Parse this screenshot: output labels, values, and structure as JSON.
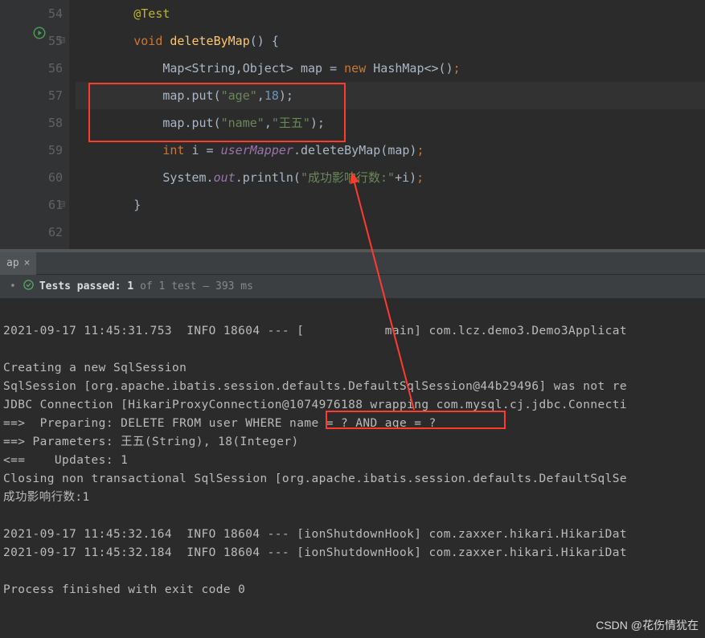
{
  "gutter": {
    "lines": [
      "54",
      "55",
      "56",
      "57",
      "58",
      "59",
      "60",
      "61",
      "62"
    ]
  },
  "code": {
    "l54_ann": "@Test",
    "l55_kw": "void",
    "l55_name": "deleteByMap",
    "l55_paren": "()",
    "l55_brace": " {",
    "l56_a": "Map<String,Object> map = ",
    "l56_new": "new ",
    "l56_b": "HashMap<>()",
    "l56_end": ";",
    "l57_a": "map.put(",
    "l57_k": "\"age\"",
    "l57_c": ",",
    "l57_v": "18",
    "l57_end": ");",
    "l58_a": "map.put(",
    "l58_k": "\"name\"",
    "l58_c": ",",
    "l58_v": "\"王五\"",
    "l58_end": ");",
    "l59_int": "int ",
    "l59_a": "i = ",
    "l59_b": "userMapper",
    "l59_c": ".deleteByMap(map)",
    "l59_end": ";",
    "l60_a": "System.",
    "l60_out": "out",
    "l60_b": ".println(",
    "l60_str": "\"成功影响行数:\"",
    "l60_c": "+i)",
    "l60_end": ";",
    "l61_brace": "}"
  },
  "tab": {
    "label": "ap",
    "close_glyph": "×"
  },
  "results": {
    "prefix": "Tests passed:",
    "count": "1",
    "of": "of 1 test",
    "dash": "– 393 ms"
  },
  "console": {
    "lines": [
      "2021-09-17 11:45:31.753  INFO 18604 --- [           main] com.lcz.demo3.Demo3Applicat",
      "",
      "Creating a new SqlSession",
      "SqlSession [org.apache.ibatis.session.defaults.DefaultSqlSession@44b29496] was not re",
      "JDBC Connection [HikariProxyConnection@1074976188 wrapping com.mysql.cj.jdbc.Connecti",
      "==>  Preparing: DELETE FROM user WHERE name = ? AND age = ?",
      "==> Parameters: 王五(String), 18(Integer)",
      "<==    Updates: 1",
      "Closing non transactional SqlSession [org.apache.ibatis.session.defaults.DefaultSqlSe",
      "成功影响行数:1",
      "",
      "2021-09-17 11:45:32.164  INFO 18604 --- [ionShutdownHook] com.zaxxer.hikari.HikariDat",
      "2021-09-17 11:45:32.184  INFO 18604 --- [ionShutdownHook] com.zaxxer.hikari.HikariDat",
      "",
      "Process finished with exit code 0"
    ]
  },
  "watermark": "CSDN @花伤情犹在"
}
